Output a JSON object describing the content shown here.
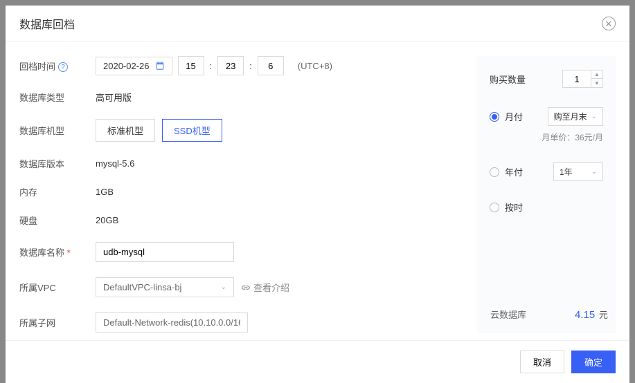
{
  "modal": {
    "title": "数据库回档"
  },
  "form": {
    "rollback_time": {
      "label": "回档时间",
      "date": "2020-02-26",
      "hour": "15",
      "minute": "23",
      "second": "6",
      "tz": "(UTC+8)"
    },
    "db_type": {
      "label": "数据库类型",
      "value": "高可用版"
    },
    "machine_type": {
      "label": "数据库机型",
      "options": [
        "标准机型",
        "SSD机型"
      ],
      "selected": "SSD机型"
    },
    "db_version": {
      "label": "数据库版本",
      "value": "mysql-5.6"
    },
    "memory": {
      "label": "内存",
      "value": "1GB"
    },
    "disk": {
      "label": "硬盘",
      "value": "20GB"
    },
    "db_name": {
      "label": "数据库名称",
      "value": "udb-mysql"
    },
    "vpc": {
      "label": "所属VPC",
      "value": "DefaultVPC-linsa-bj",
      "link_text": "查看介绍"
    },
    "subnet": {
      "label": "所属子网",
      "value": "Default-Network-redis(10.10.0.0/16"
    }
  },
  "purchase": {
    "qty_label": "购买数量",
    "qty": "1",
    "options": {
      "monthly": {
        "label": "月付",
        "select_value": "购至月末",
        "price_hint": "月单价：36元/月"
      },
      "yearly": {
        "label": "年付",
        "select_value": "1年"
      },
      "hourly": {
        "label": "按时"
      }
    },
    "selected": "monthly"
  },
  "footer": {
    "summary_label": "云数据库",
    "price": "4.15",
    "price_unit": "元",
    "cancel": "取消",
    "confirm": "确定"
  }
}
